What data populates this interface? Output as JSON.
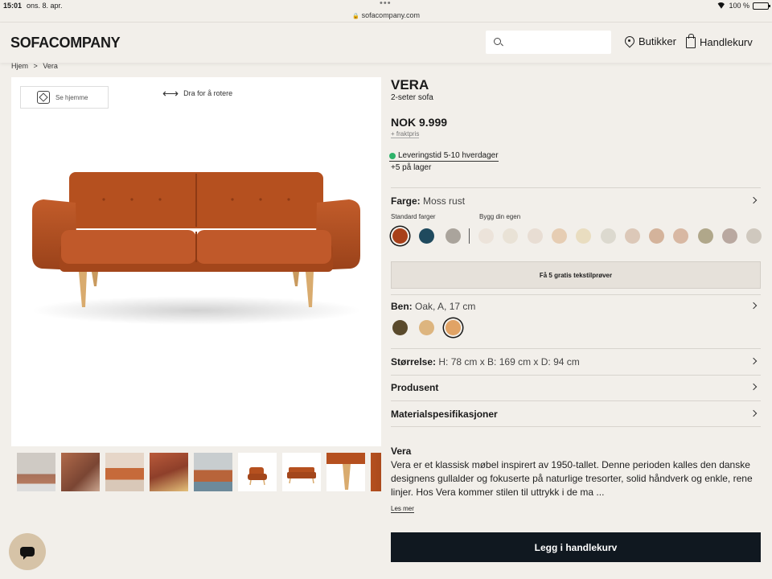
{
  "status_bar": {
    "time": "15:01",
    "date": "ons. 8. apr.",
    "url": "sofacompany.com",
    "battery": "100 %"
  },
  "header": {
    "logo": "SOFACOMPANY",
    "search_placeholder": "",
    "stores_label": "Butikker",
    "cart_label": "Handlekurv"
  },
  "breadcrumb": {
    "home": "Hjem",
    "separator": ">",
    "current": "Vera"
  },
  "gallery": {
    "see_home_label": "Se hjemme",
    "rotate_hint": "Dra for å rotere",
    "product_color": "#b04f22",
    "thumbnail_count": 9
  },
  "product": {
    "title": "VERA",
    "subtitle": "2-seter sofa",
    "price": "NOK 9.999",
    "freight": "+ fraktpris",
    "delivery": "Leveringstid 5-10 hverdager",
    "stock": "+5 på lager"
  },
  "color": {
    "label": "Farge:",
    "value": "Moss rust",
    "standard_heading": "Standard farger",
    "custom_heading": "Bygg din egen",
    "standard_swatches": [
      "#a8401a",
      "#1f4a5e",
      "#aaa49c"
    ],
    "custom_swatches": [
      "#ece3da",
      "#e9e2d6",
      "#e8ddd3",
      "#e6cdb3",
      "#e9ddc0",
      "#dcd9cf",
      "#dcc8b8",
      "#d4b39b",
      "#d8b8a3",
      "#b0a78a",
      "#b9a8a0",
      "#cfc8be"
    ],
    "selected_index": 0
  },
  "samples_button": "Få 5 gratis tekstilprøver",
  "legs": {
    "label": "Ben:",
    "value": "Oak, A, 17 cm",
    "swatches": [
      "#5a4a2c",
      "#ddb57f",
      "#e1a365"
    ],
    "selected_index": 2
  },
  "size": {
    "label": "Størrelse:",
    "value": "H: 78 cm x B: 169 cm x D: 94 cm"
  },
  "producer": {
    "label": "Produsent"
  },
  "materials": {
    "label": "Materialspesifikasjoner"
  },
  "description": {
    "title": "Vera",
    "text": "Vera er et klassisk møbel inspirert av 1950-tallet. Denne perioden kalles den danske designens gullalder og fokuserte på naturlige tresorter, solid håndverk og enkle, rene linjer. Hos Vera kommer stilen til uttrykk i de ma ...",
    "read_more": "Les mer"
  },
  "add_to_cart": "Legg i handlekurv"
}
